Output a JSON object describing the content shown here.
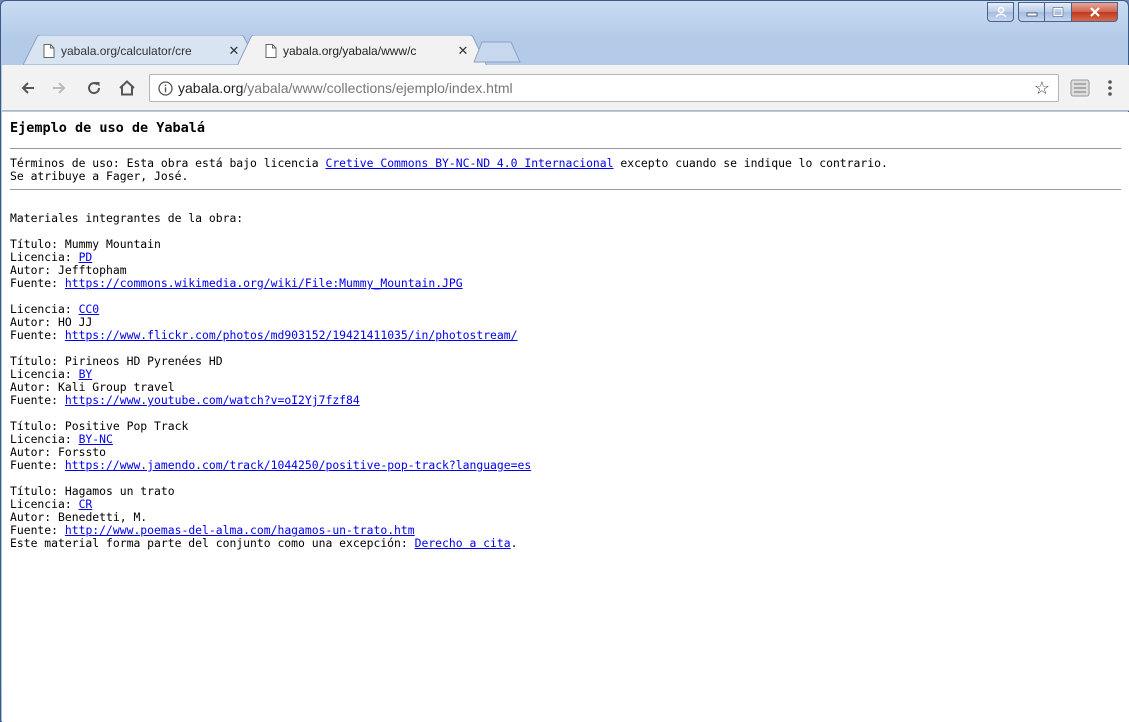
{
  "browser": {
    "tabs": [
      {
        "title": "yabala.org/calculator/cre",
        "close": "✕",
        "active": false
      },
      {
        "title": "yabala.org/yabala/www/c",
        "close": "✕",
        "active": true
      }
    ],
    "url": {
      "host": "yabala.org",
      "path": "/yabala/www/collections/ejemplo/index.html"
    },
    "star": "☆"
  },
  "page": {
    "title": "Ejemplo de uso de Yabalá",
    "terms": {
      "prefix": "Términos de uso: Esta obra está bajo licencia ",
      "link": "Cretive Commons BY-NC-ND 4.0 Internacional",
      "suffix": " excepto cuando se indique lo contrario.",
      "attribution": "Se atribuye a Fager, José."
    },
    "intro": "Materiales integrantes de la obra:",
    "labels": {
      "titulo": "Título: ",
      "licencia": "Licencia: ",
      "autor": "Autor: ",
      "fuente": "Fuente: "
    },
    "materials": [
      {
        "title": "Mummy Mountain",
        "license": "PD",
        "author": "Jefftopham",
        "source": "https://commons.wikimedia.org/wiki/File:Mummy_Mountain.JPG"
      },
      {
        "title": "",
        "license": "CC0",
        "author": "HO JJ",
        "source": "https://www.flickr.com/photos/md903152/19421411035/in/photostream/"
      },
      {
        "title": "Pirineos HD Pyrenées HD",
        "license": "BY",
        "author": "Kali Group travel",
        "source": "https://www.youtube.com/watch?v=oI2Yj7fzf84"
      },
      {
        "title": "Positive Pop Track",
        "license": "BY-NC",
        "author": "Forssto",
        "source": "https://www.jamendo.com/track/1044250/positive-pop-track?language=es"
      },
      {
        "title": "Hagamos un trato",
        "license": "CR",
        "author": "Benedetti, M.",
        "source": "http://www.poemas-del-alma.com/hagamos-un-trato.htm"
      }
    ],
    "exception": {
      "text": "Este material forma parte del conjunto como una excepción: ",
      "link": "Derecho a cita",
      "end": "."
    }
  }
}
